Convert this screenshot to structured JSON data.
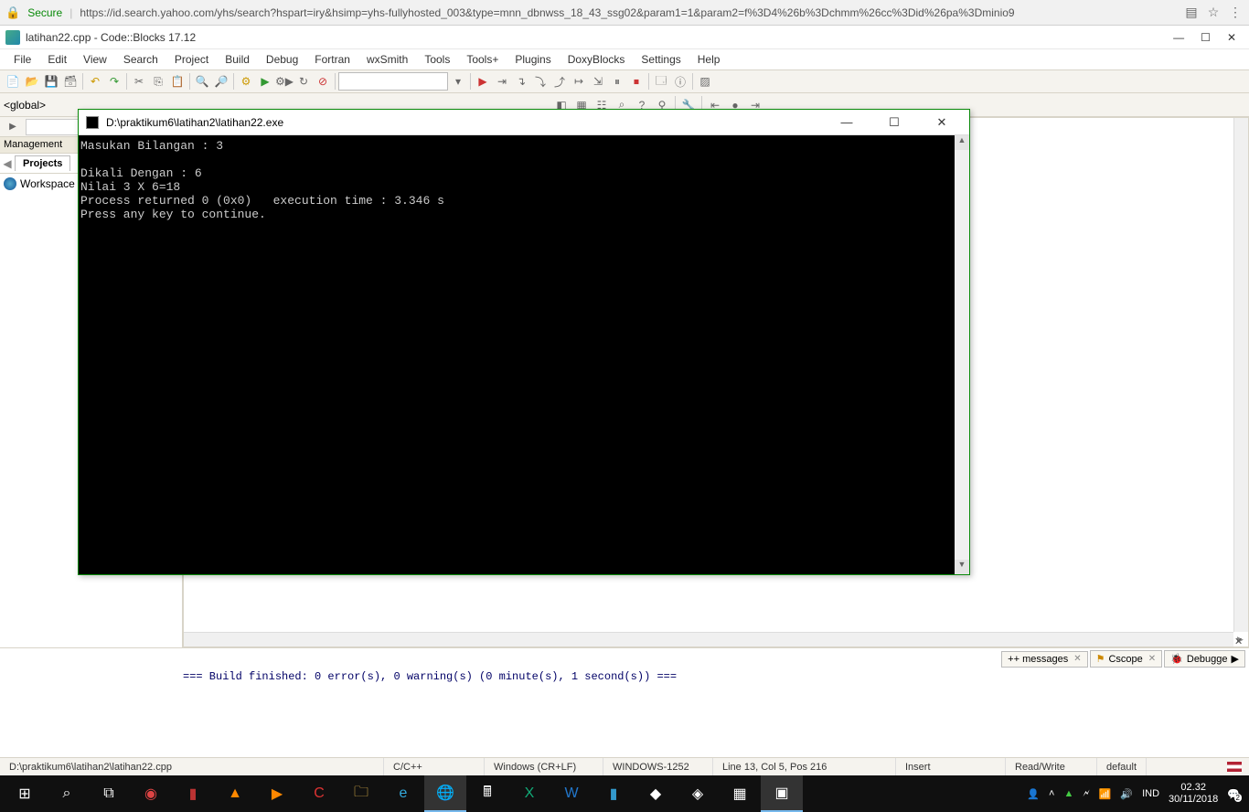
{
  "browser": {
    "secure": "Secure",
    "url": "https://id.search.yahoo.com/yhs/search?hspart=iry&hsimp=yhs-fullyhosted_003&type=mnn_dbnwss_18_43_ssg02&param1=1&param2=f%3D4%26b%3Dchmm%26cc%3Did%26pa%3Dminio9"
  },
  "ide": {
    "title": "latihan22.cpp - Code::Blocks 17.12",
    "menu": [
      "File",
      "Edit",
      "View",
      "Search",
      "Project",
      "Build",
      "Debug",
      "Fortran",
      "wxSmith",
      "Tools",
      "Tools+",
      "Plugins",
      "DoxyBlocks",
      "Settings",
      "Help"
    ],
    "scope": "<global>",
    "mgmt_title": "Management",
    "projects_tab": "Projects",
    "workspace": "Workspace",
    "log_tabs": {
      "msgs": "++ messages",
      "cscope": "Cscope",
      "debug": "Debugge"
    },
    "log_line": "=== Build finished: 0 error(s), 0 warning(s) (0 minute(s), 1 second(s)) ===",
    "status": {
      "path": "D:\\praktikum6\\latihan2\\latihan22.cpp",
      "lang": "C/C++",
      "eol": "Windows (CR+LF)",
      "enc": "WINDOWS-1252",
      "pos": "Line 13, Col 5, Pos 216",
      "ins": "Insert",
      "rw": "Read/Write",
      "prof": "default"
    }
  },
  "console": {
    "title": "D:\\praktikum6\\latihan2\\latihan22.exe",
    "output": "Masukan Bilangan : 3\n\nDikali Dengan : 6\nNilai 3 X 6=18\nProcess returned 0 (0x0)   execution time : 3.346 s\nPress any key to continue."
  },
  "taskbar": {
    "lang": "IND",
    "time": "02.32",
    "date": "30/11/2018",
    "notif": "2"
  }
}
